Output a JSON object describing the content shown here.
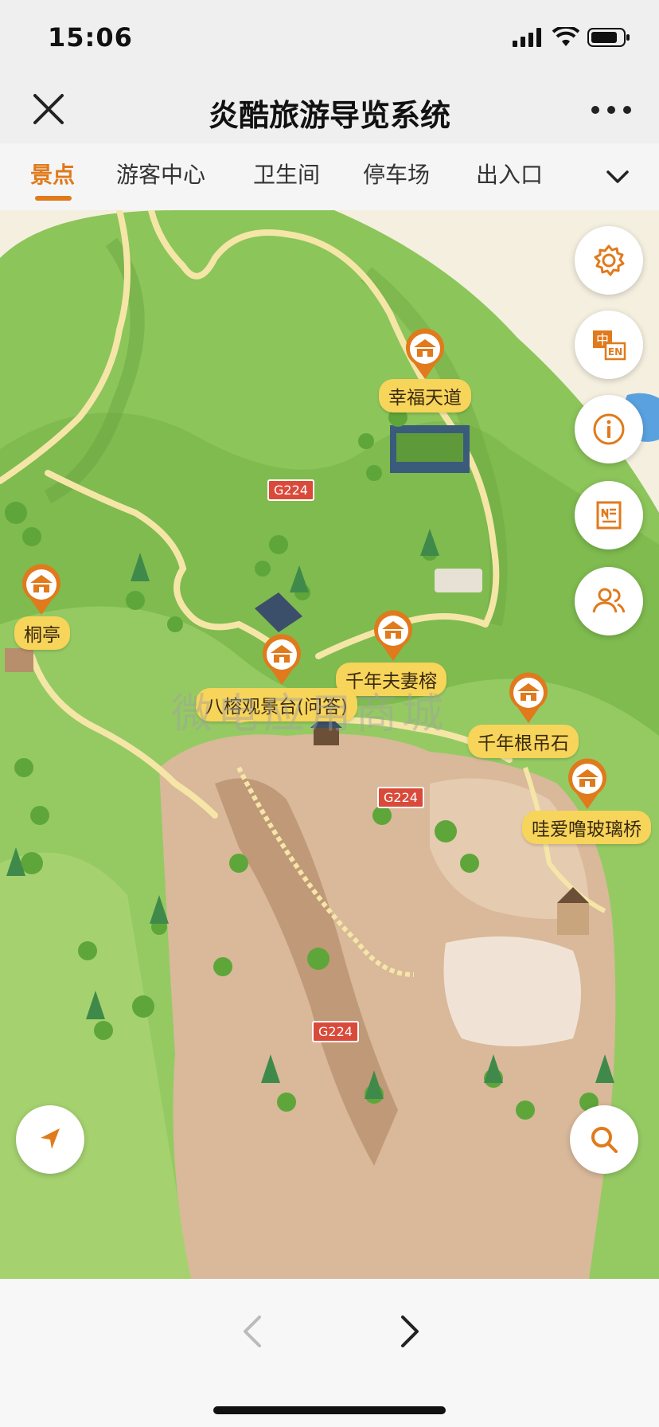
{
  "status": {
    "time": "15:06"
  },
  "header": {
    "title": "炎酷旅游导览系统"
  },
  "tabs": [
    {
      "label": "景点",
      "active": true
    },
    {
      "label": "游客中心",
      "active": false
    },
    {
      "label": "卫生间",
      "active": false
    },
    {
      "label": "停车场",
      "active": false
    },
    {
      "label": "出入口",
      "active": false
    }
  ],
  "map": {
    "pois": [
      {
        "name": "幸福天道"
      },
      {
        "name": "桐亭"
      },
      {
        "name": "千年夫妻榕"
      },
      {
        "name": "八榕观景台(问答)"
      },
      {
        "name": "千年根吊石"
      },
      {
        "name": "哇爱噜玻璃桥"
      }
    ],
    "road_badges": [
      "G224",
      "G224",
      "G224"
    ],
    "watermark": "微电应用商城"
  },
  "side_buttons": {
    "settings": "gear-icon",
    "language": {
      "zh": "中",
      "en": "EN"
    },
    "info": "info-icon",
    "notes": "document-icon",
    "users": "users-icon"
  },
  "colors": {
    "accent": "#e07a1c",
    "label_bg": "#f7d45a",
    "grass": "#8cc55a",
    "path": "#f5e6a8"
  }
}
